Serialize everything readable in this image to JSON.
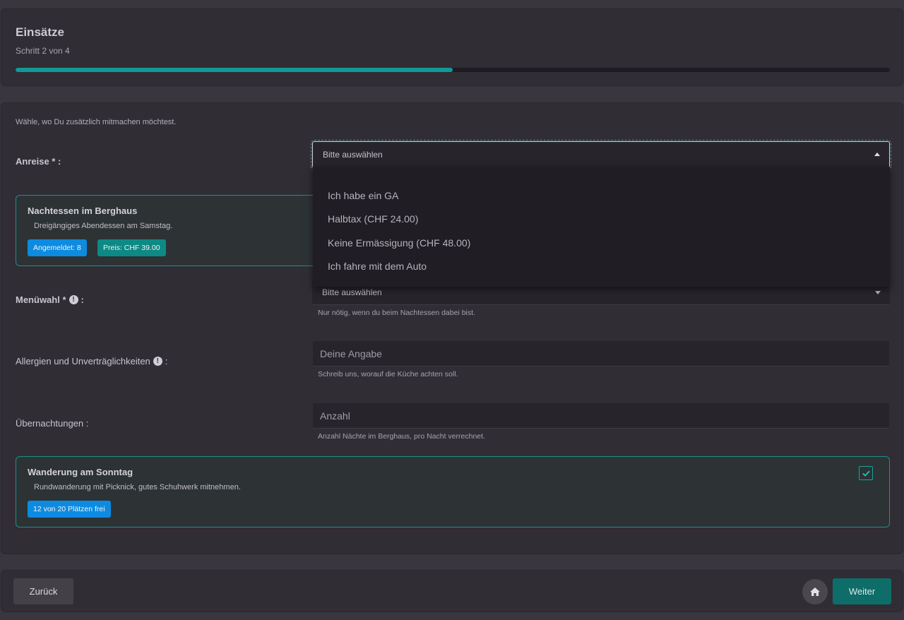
{
  "header": {
    "title": "Einsätze",
    "step": "Schritt 2 von 4",
    "progress_percent": 50
  },
  "form": {
    "intro": "Wähle, wo Du zusätzlich mitmachen möchtest.",
    "anreise": {
      "label": "Anreise * :",
      "value": "Bitte auswählen",
      "options": [
        "Ich habe ein GA",
        "Halbtax (CHF 24.00)",
        "Keine Ermässigung (CHF 48.00)",
        "Ich fahre mit dem Auto"
      ]
    },
    "nachtessen": {
      "title": "Nachtessen im Berghaus",
      "description": "Dreigängiges Abendessen am Samstag.",
      "badge_registered": "Angemeldet: 8",
      "badge_price": "Preis: CHF 39.00"
    },
    "menuwahl": {
      "label": "Menüwahl *",
      "label_suffix": ":",
      "value": "Bitte auswählen",
      "hint": "Nur nötig, wenn du beim Nachtessen dabei bist."
    },
    "allergien": {
      "label": "Allergien und Unverträglichkeiten",
      "label_suffix": ":",
      "placeholder": "Deine Angabe",
      "hint": "Schreib uns, worauf die Küche achten soll."
    },
    "uebernachtungen": {
      "label": "Übernachtungen :",
      "placeholder": "Anzahl",
      "hint": "Anzahl Nächte im Berghaus, pro Nacht verrechnet."
    },
    "wanderung": {
      "title": "Wanderung am Sonntag",
      "description": "Rundwanderung mit Picknick, gutes Schuhwerk mitnehmen.",
      "badge_places": "12 von 20 Plätzen frei",
      "checked": true
    }
  },
  "footer": {
    "back_label": "Zurück",
    "next_label": "Weiter"
  },
  "icons": {
    "info": "info-circle-icon",
    "home": "home-icon",
    "check": "checkmark-icon"
  },
  "colors": {
    "accent": "#119a98",
    "badge_blue": "#0d8be0",
    "badge_teal": "#0d8a85"
  }
}
